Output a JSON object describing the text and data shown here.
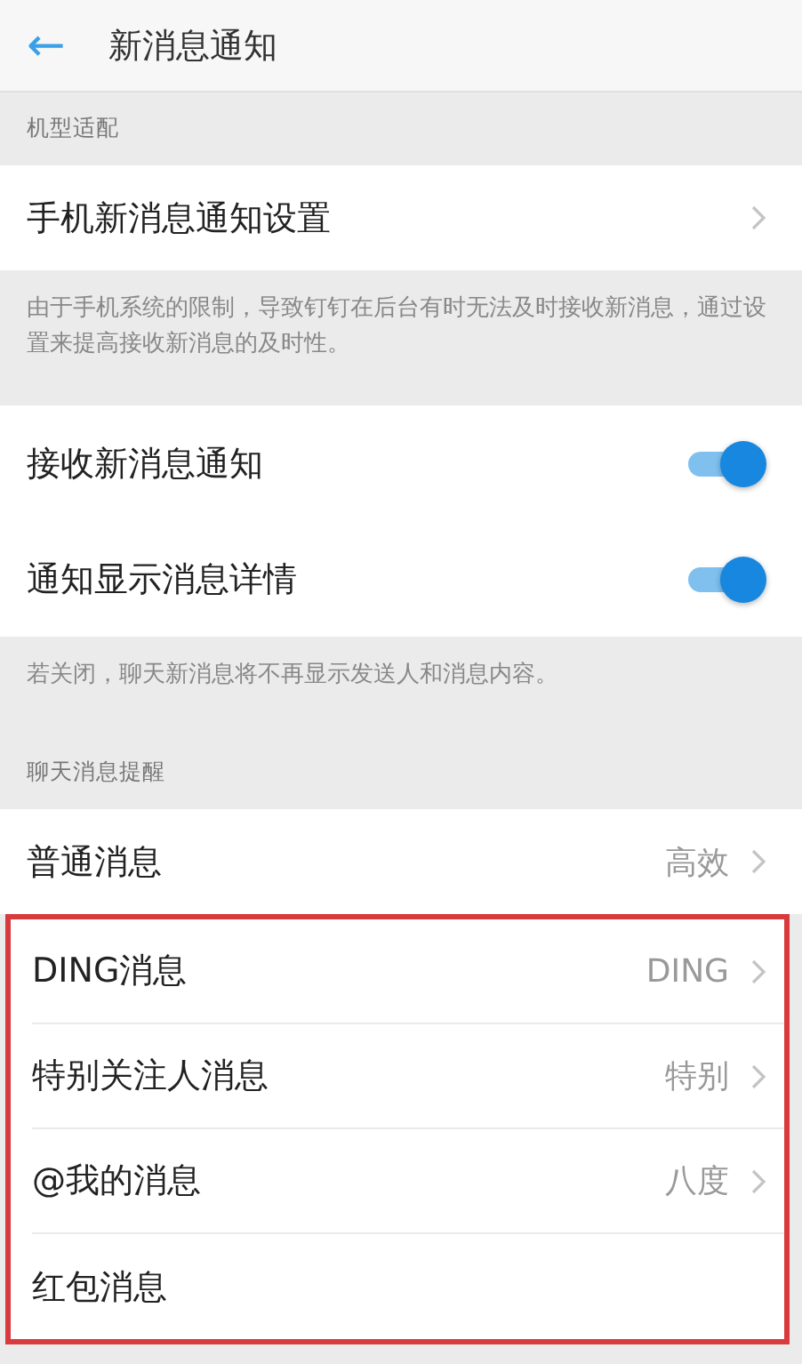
{
  "header": {
    "back": "←",
    "title": "新消息通知"
  },
  "items": [
    {
      "kind": "section_label",
      "text": "机型适配"
    },
    {
      "kind": "link",
      "label": "手机新消息通知设置",
      "chevron": true,
      "highlighted": false,
      "divider": false
    },
    {
      "kind": "note",
      "text": "由于手机系统的限制，导致钉钉在后台有时无法及时接收新消息，通过设置来提高接收新消息的及时性。"
    },
    {
      "kind": "toggle",
      "label": "接收新消息通知",
      "on": true
    },
    {
      "kind": "toggle",
      "label": "通知显示消息详情",
      "on": true
    },
    {
      "kind": "note",
      "text": "若关闭，聊天新消息将不再显示发送人和消息内容。"
    },
    {
      "kind": "section_label",
      "text": "聊天消息提醒"
    },
    {
      "kind": "link",
      "label": "普通消息",
      "value": "高效",
      "chevron": true,
      "highlighted": false,
      "divider": false
    },
    {
      "kind": "link",
      "label": "DING消息",
      "value": "DING",
      "chevron": true,
      "highlighted": true,
      "divider": true
    },
    {
      "kind": "link",
      "label": "特别关注人消息",
      "value": "特别",
      "chevron": true,
      "highlighted": true,
      "divider": true
    },
    {
      "kind": "link",
      "label": "@我的消息",
      "value": "八度",
      "chevron": true,
      "highlighted": true,
      "divider": true
    },
    {
      "kind": "link",
      "label": "红包消息",
      "chevron": false,
      "highlighted": true,
      "divider": false
    }
  ]
}
